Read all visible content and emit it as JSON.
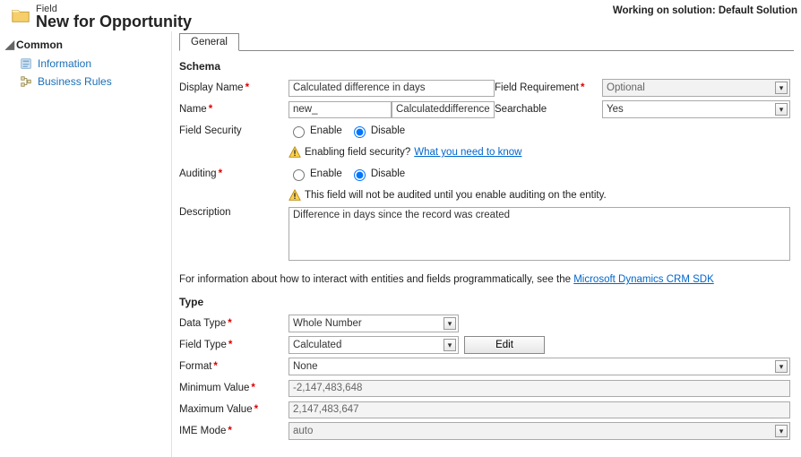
{
  "header": {
    "smallTitle": "Field",
    "bigTitle": "New for Opportunity",
    "solution": "Working on solution: Default Solution"
  },
  "sidebar": {
    "section": "Common",
    "items": [
      {
        "label": "Information"
      },
      {
        "label": "Business Rules"
      }
    ]
  },
  "tab": {
    "general": "General"
  },
  "schema": {
    "heading": "Schema",
    "displayName": {
      "label": "Display Name",
      "value": "Calculated difference in days"
    },
    "fieldRequirement": {
      "label": "Field Requirement",
      "value": "Optional"
    },
    "name": {
      "label": "Name",
      "prefix": "new_",
      "value": "Calculateddifferenceindays"
    },
    "searchable": {
      "label": "Searchable",
      "value": "Yes"
    },
    "fieldSecurity": {
      "label": "Field Security",
      "enable": "Enable",
      "disable": "Disable",
      "warnText": "Enabling field security?",
      "warnLink": "What you need to know"
    },
    "auditing": {
      "label": "Auditing",
      "enable": "Enable",
      "disable": "Disable",
      "warnText": "This field will not be audited until you enable auditing on the entity."
    },
    "description": {
      "label": "Description",
      "value": "Difference in days since the record was created"
    },
    "sdkInfo": {
      "text": "For information about how to interact with entities and fields programmatically, see the ",
      "link": "Microsoft Dynamics CRM SDK"
    }
  },
  "type": {
    "heading": "Type",
    "dataType": {
      "label": "Data Type",
      "value": "Whole Number"
    },
    "fieldType": {
      "label": "Field Type",
      "value": "Calculated",
      "editLabel": "Edit"
    },
    "format": {
      "label": "Format",
      "value": "None"
    },
    "minVal": {
      "label": "Minimum Value",
      "value": "-2,147,483,648"
    },
    "maxVal": {
      "label": "Maximum Value",
      "value": "2,147,483,647"
    },
    "imeMode": {
      "label": "IME Mode",
      "value": "auto"
    }
  }
}
